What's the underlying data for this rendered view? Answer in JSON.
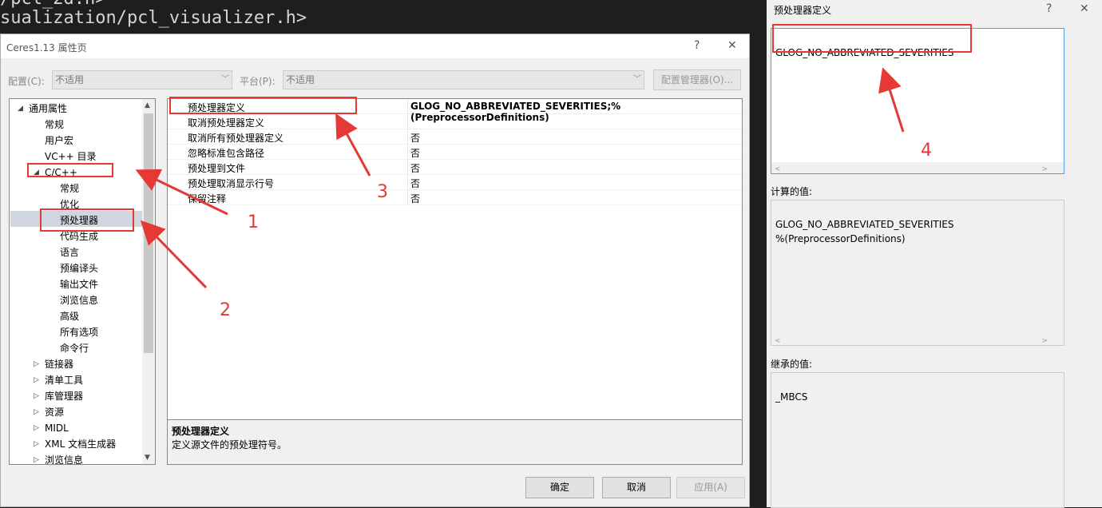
{
  "editor": {
    "line1": "/pcl_2d.h>",
    "line2": "sualization/pcl_visualizer.h>"
  },
  "dialog": {
    "title": "Ceres1.13 属性页",
    "help_glyph": "?",
    "close_glyph": "✕",
    "config_label": "配置(C):",
    "config_value": "不适用",
    "platform_label": "平台(P):",
    "platform_value": "不适用",
    "config_manager_label": "配置管理器(O)...",
    "tree": [
      {
        "label": "通用属性",
        "level": 0,
        "arrow": "expanded"
      },
      {
        "label": "常规",
        "level": 1,
        "arrow": "none"
      },
      {
        "label": "用户宏",
        "level": 1,
        "arrow": "none"
      },
      {
        "label": "VC++ 目录",
        "level": 1,
        "arrow": "none"
      },
      {
        "label": "C/C++",
        "level": 1,
        "arrow": "expanded"
      },
      {
        "label": "常规",
        "level": 2,
        "arrow": "none"
      },
      {
        "label": "优化",
        "level": 2,
        "arrow": "none"
      },
      {
        "label": "预处理器",
        "level": 2,
        "arrow": "none",
        "selected": true
      },
      {
        "label": "代码生成",
        "level": 2,
        "arrow": "none"
      },
      {
        "label": "语言",
        "level": 2,
        "arrow": "none"
      },
      {
        "label": "预编译头",
        "level": 2,
        "arrow": "none"
      },
      {
        "label": "输出文件",
        "level": 2,
        "arrow": "none"
      },
      {
        "label": "浏览信息",
        "level": 2,
        "arrow": "none"
      },
      {
        "label": "高级",
        "level": 2,
        "arrow": "none"
      },
      {
        "label": "所有选项",
        "level": 2,
        "arrow": "none"
      },
      {
        "label": "命令行",
        "level": 2,
        "arrow": "none"
      },
      {
        "label": "链接器",
        "level": 1,
        "arrow": "collapsed"
      },
      {
        "label": "清单工具",
        "level": 1,
        "arrow": "collapsed"
      },
      {
        "label": "库管理器",
        "level": 1,
        "arrow": "collapsed"
      },
      {
        "label": "资源",
        "level": 1,
        "arrow": "collapsed"
      },
      {
        "label": "MIDL",
        "level": 1,
        "arrow": "collapsed"
      },
      {
        "label": "XML 文档生成器",
        "level": 1,
        "arrow": "collapsed"
      },
      {
        "label": "浏览信息",
        "level": 1,
        "arrow": "collapsed"
      }
    ],
    "properties": [
      {
        "name": "预处理器定义",
        "value": "GLOG_NO_ABBREVIATED_SEVERITIES;%(PreprocessorDefinitions)",
        "bold": true
      },
      {
        "name": "取消预处理器定义",
        "value": ""
      },
      {
        "name": "取消所有预处理器定义",
        "value": "否"
      },
      {
        "name": "忽略标准包含路径",
        "value": "否"
      },
      {
        "name": "预处理到文件",
        "value": "否"
      },
      {
        "name": "预处理取消显示行号",
        "value": "否"
      },
      {
        "name": "保留注释",
        "value": "否"
      }
    ],
    "description": {
      "title": "预处理器定义",
      "text": "定义源文件的预处理符号。"
    },
    "buttons": {
      "ok": "确定",
      "cancel": "取消",
      "apply": "应用(A)"
    }
  },
  "side_panel": {
    "title": "预处理器定义",
    "help_glyph": "?",
    "close_glyph": "✕",
    "edit_value": "GLOG_NO_ABBREVIATED_SEVERITIES",
    "computed_label": "计算的值:",
    "computed_value": "GLOG_NO_ABBREVIATED_SEVERITIES\n%(PreprocessorDefinitions)",
    "inherited_label": "继承的值:",
    "inherited_value": "_MBCS"
  },
  "annotations": {
    "numbers": [
      "1",
      "2",
      "3",
      "4"
    ],
    "color": "#e53935"
  }
}
